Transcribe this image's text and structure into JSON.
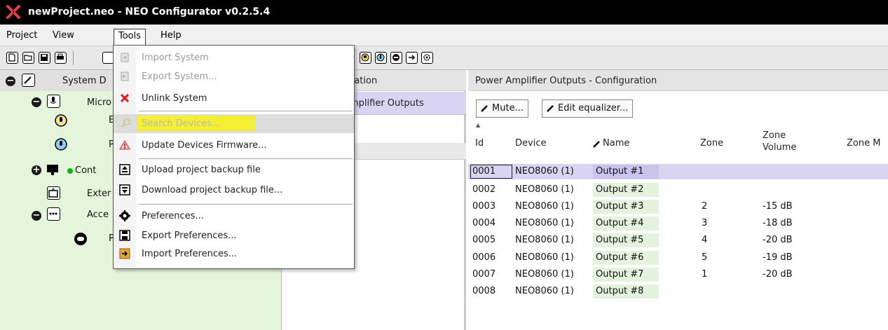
{
  "window": {
    "title": "newProject.neo - NEO Configurator v0.2.5.4"
  },
  "menubar": {
    "items": [
      "Project",
      "View",
      "Tools",
      "Help"
    ]
  },
  "tree": {
    "items": [
      {
        "label": "System D",
        "icon": "pencil-icon",
        "toggle": "−"
      },
      {
        "label": "Micro",
        "icon": "microphone-icon",
        "toggle": "−"
      },
      {
        "label": "E",
        "icon": "microphone-round-icon"
      },
      {
        "label": "P",
        "icon": "microphone-blue-icon"
      },
      {
        "label": "Cont",
        "icon": "monitor-icon",
        "toggle": "+"
      },
      {
        "label": "Exter",
        "icon": "box-icon"
      },
      {
        "label": "Acce",
        "icon": "dots-icon",
        "toggle": "−"
      },
      {
        "label": "P",
        "icon": "round-button-icon"
      }
    ]
  },
  "middle": {
    "header": "ration",
    "row": "mplifier Outputs"
  },
  "right": {
    "header": "Power Amplifier Outputs - Configuration",
    "mute_label": "Mute...",
    "equalizer_label": "Edit equalizer...",
    "columns": [
      "Id",
      "Device",
      "Name",
      "Zone",
      "Zone",
      "Volume",
      "Zone M"
    ],
    "rows": [
      {
        "id": "0001",
        "device": "NEO8060 (1)",
        "name": "Output #1",
        "zone": "",
        "volume": ""
      },
      {
        "id": "0002",
        "device": "NEO8060 (1)",
        "name": "Output #2",
        "zone": "",
        "volume": ""
      },
      {
        "id": "0003",
        "device": "NEO8060 (1)",
        "name": "Output #3",
        "zone": "2",
        "volume": "-15 dB"
      },
      {
        "id": "0004",
        "device": "NEO8060 (1)",
        "name": "Output #4",
        "zone": "3",
        "volume": "-18 dB"
      },
      {
        "id": "0005",
        "device": "NEO8060 (1)",
        "name": "Output #5",
        "zone": "4",
        "volume": "-20 dB"
      },
      {
        "id": "0006",
        "device": "NEO8060 (1)",
        "name": "Output #6",
        "zone": "5",
        "volume": "-19 dB"
      },
      {
        "id": "0007",
        "device": "NEO8060 (1)",
        "name": "Output #7",
        "zone": "1",
        "volume": "-20 dB"
      },
      {
        "id": "0008",
        "device": "NEO8060 (1)",
        "name": "Output #8",
        "zone": "",
        "volume": ""
      }
    ]
  },
  "tools_menu": {
    "items": [
      {
        "label": "Import System",
        "icon": "import-system-icon",
        "disabled": true
      },
      {
        "label": "Export System...",
        "icon": "export-system-icon",
        "disabled": true
      },
      {
        "label": "Unlink System",
        "icon": "red-x-icon",
        "disabled": false
      },
      {
        "label": "Search Devices...",
        "icon": "search-icon",
        "disabled": true,
        "highlighted": true
      },
      {
        "label": "Update Devices Firmware...",
        "icon": "warning-icon",
        "disabled": false
      },
      {
        "label": "Upload project backup file",
        "icon": "upload-icon",
        "disabled": false
      },
      {
        "label": "Download project backup file...",
        "icon": "download-icon",
        "disabled": false
      },
      {
        "label": "Preferences...",
        "icon": "gear-icon",
        "disabled": false
      },
      {
        "label": "Export Preferences...",
        "icon": "save-icon",
        "disabled": false
      },
      {
        "label": "Import Preferences...",
        "icon": "import-prefs-icon",
        "disabled": false
      }
    ]
  },
  "colors": {
    "titlebar": "#000000",
    "tree_bg": "#e5f5dc",
    "selection": "#d9d4f2",
    "highlight_yellow": "#f5ef34",
    "name_cell": "#e4f3dd",
    "status_green": "#10b610",
    "unlink_red": "#e01818"
  }
}
